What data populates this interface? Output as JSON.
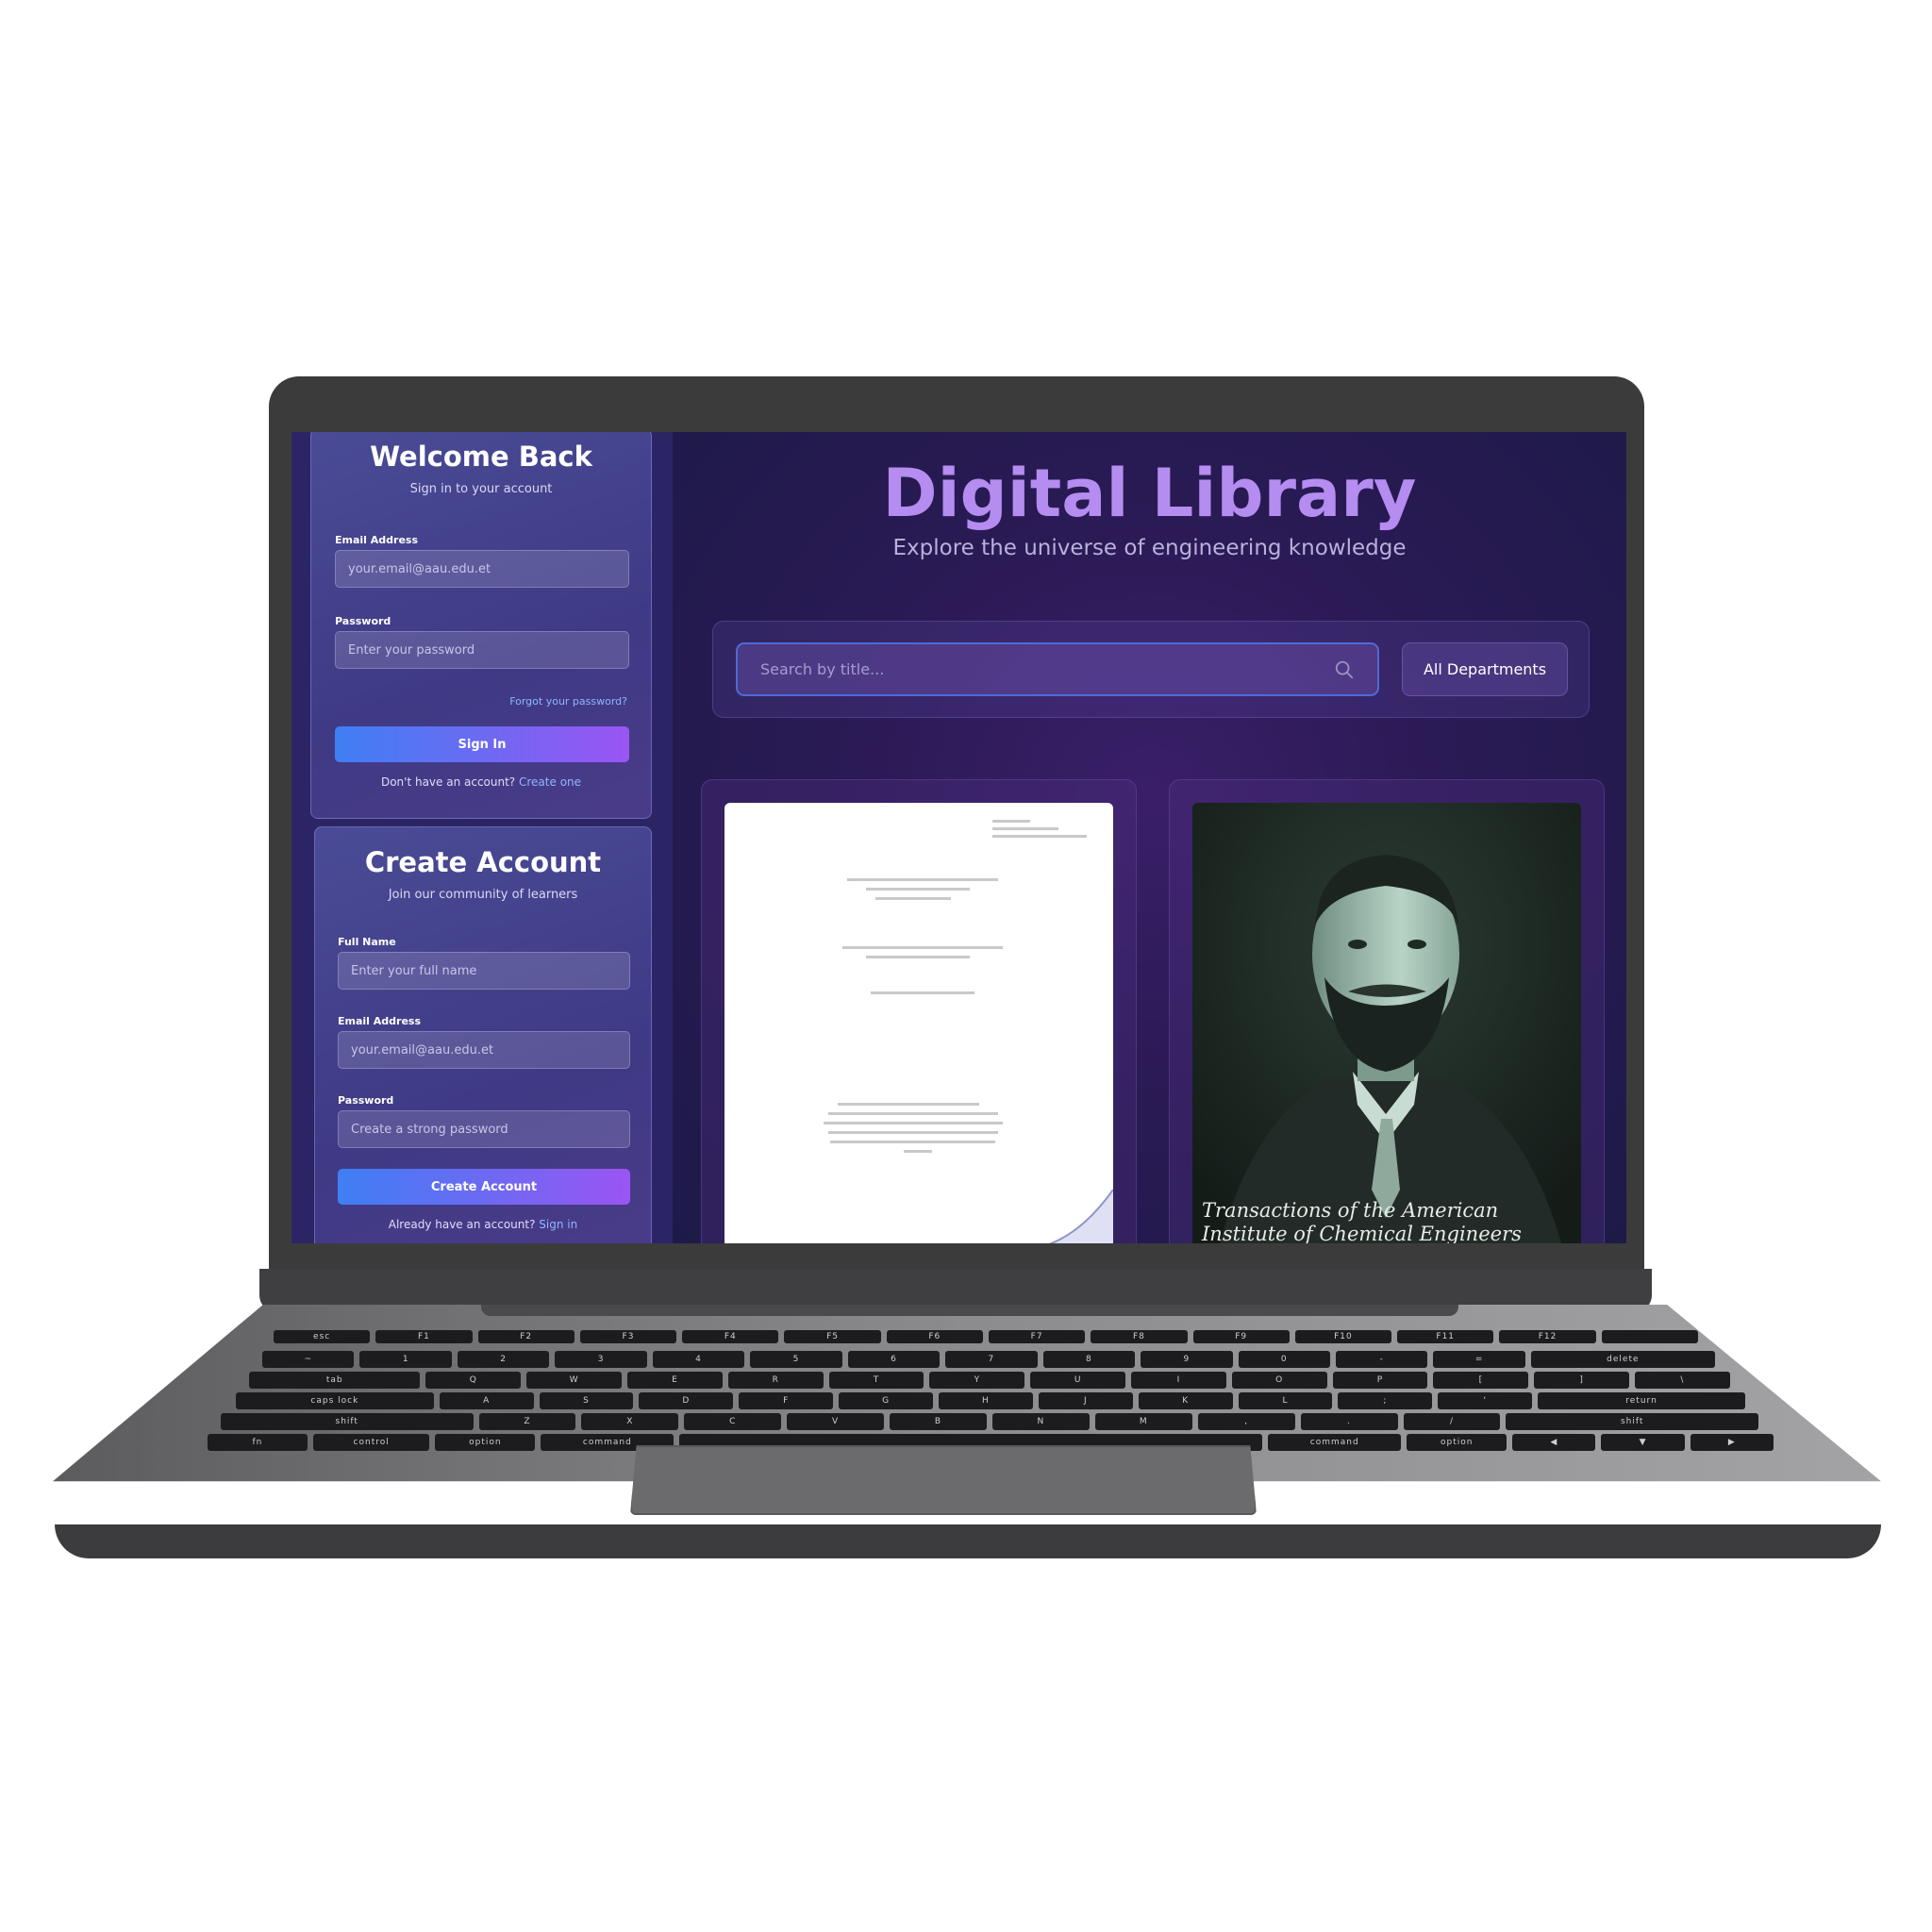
{
  "login": {
    "title": "Welcome Back",
    "subtitle": "Sign in to your account",
    "email_label": "Email Address",
    "email_placeholder": "your.email@aau.edu.et",
    "password_label": "Password",
    "password_placeholder": "Enter your password",
    "forgot_link": "Forgot your password?",
    "submit_label": "Sign In",
    "footer_text": "Don't have an account?",
    "footer_link": "Create one"
  },
  "register": {
    "title": "Create Account",
    "subtitle": "Join our community of learners",
    "name_label": "Full Name",
    "name_placeholder": "Enter your full name",
    "email_label": "Email Address",
    "email_placeholder": "your.email@aau.edu.et",
    "password_label": "Password",
    "password_placeholder": "Create a strong password",
    "submit_label": "Create Account",
    "footer_text": "Already have an account?",
    "footer_link": "Sign in"
  },
  "hero": {
    "title": "Digital Library",
    "subtitle": "Explore the universe of engineering knowledge"
  },
  "search": {
    "placeholder": "Search by title...",
    "icon": "search-icon",
    "department_filter": "All Departments"
  },
  "books": [
    {
      "cover_type": "document"
    },
    {
      "cover_type": "portrait",
      "caption_line1": "Transactions of the American",
      "caption_line2": "Institute of Chemical Engineers"
    }
  ],
  "keyboard": {
    "row1": [
      "esc",
      "F1",
      "F2",
      "F3",
      "F4",
      "F5",
      "F6",
      "F7",
      "F8",
      "F9",
      "F10",
      "F11",
      "F12",
      ""
    ],
    "row2": [
      "~",
      "1",
      "2",
      "3",
      "4",
      "5",
      "6",
      "7",
      "8",
      "9",
      "0",
      "-",
      "=",
      "delete"
    ],
    "row3": [
      "tab",
      "Q",
      "W",
      "E",
      "R",
      "T",
      "Y",
      "U",
      "I",
      "O",
      "P",
      "[",
      "]",
      "\\"
    ],
    "row4": [
      "caps lock",
      "A",
      "S",
      "D",
      "F",
      "G",
      "H",
      "J",
      "K",
      "L",
      ";",
      "'",
      "return"
    ],
    "row5": [
      "shift",
      "Z",
      "X",
      "C",
      "V",
      "B",
      "N",
      "M",
      ",",
      ".",
      "/",
      "shift"
    ],
    "row6": [
      "fn",
      "control",
      "option",
      "command",
      "",
      "command",
      "option",
      "◀",
      "▼",
      "▶"
    ]
  },
  "colors": {
    "accent_gradient_start": "#3f7ff3",
    "accent_gradient_end": "#9a55f2",
    "title_color": "#b58cf0",
    "link_color": "#8fb6ff"
  }
}
